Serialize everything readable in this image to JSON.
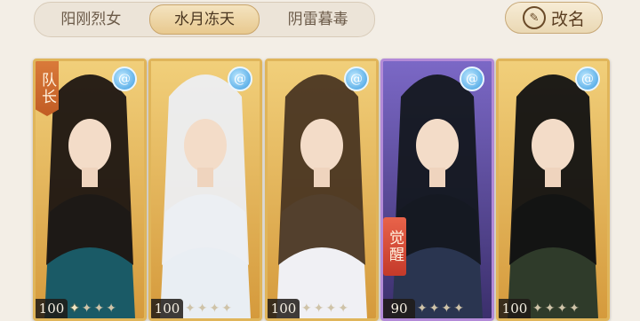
{
  "tabs": [
    {
      "label": "阳刚烈女",
      "active": false
    },
    {
      "label": "水月冻天",
      "active": true
    },
    {
      "label": "阴雷暮毒",
      "active": false
    }
  ],
  "rename_label": "改名",
  "colors": {
    "accent": "#e0b55a",
    "purple": "#b38ad8",
    "captain": "#c15c24",
    "awaken": "#d0452f"
  },
  "cards": [
    {
      "badge": "队长",
      "awaken": "",
      "level": "100",
      "element_icon": "water-swirl-icon",
      "stars": 4,
      "lit": 1,
      "bg": "gold",
      "hair": "#1e1612",
      "robe": "#1a5a66"
    },
    {
      "badge": "",
      "awaken": "",
      "level": "100",
      "element_icon": "water-swirl-icon",
      "stars": 4,
      "lit": 0,
      "bg": "gold",
      "hair": "#eceef2",
      "robe": "#e9eef3"
    },
    {
      "badge": "",
      "awaken": "",
      "level": "100",
      "element_icon": "water-swirl-icon",
      "stars": 4,
      "lit": 0,
      "bg": "gold",
      "hair": "#4a3622",
      "robe": "#f0f0f4"
    },
    {
      "badge": "",
      "awaken": "觉醒",
      "level": "90",
      "element_icon": "water-swirl-icon",
      "stars": 4,
      "lit": 0,
      "bg": "purple",
      "hair": "#141820",
      "robe": "#2a3550"
    },
    {
      "badge": "",
      "awaken": "",
      "level": "100",
      "element_icon": "water-swirl-icon",
      "stars": 4,
      "lit": 0,
      "bg": "gold",
      "hair": "#121212",
      "robe": "#2f3b2a"
    }
  ]
}
